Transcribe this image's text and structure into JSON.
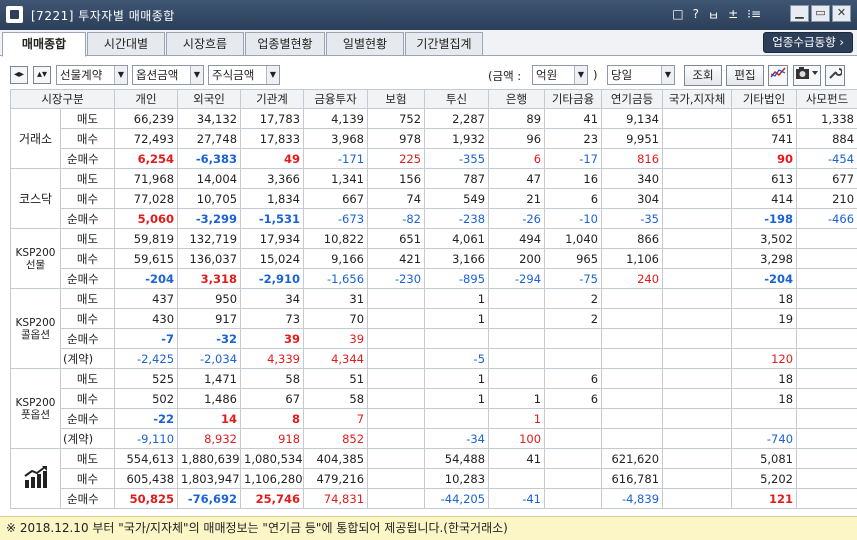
{
  "window": {
    "title": "[7221] 투자자별 매매종합",
    "icons": [
      "□",
      "?",
      "ㅂ",
      "±",
      "⁝≡"
    ],
    "buttons": [
      "▁",
      "▭",
      "✕"
    ]
  },
  "tabs": [
    {
      "label": "매매종합",
      "active": true
    },
    {
      "label": "시간대별"
    },
    {
      "label": "시장흐름"
    },
    {
      "label": "업종별현황"
    },
    {
      "label": "일별현황"
    },
    {
      "label": "기간별집계"
    }
  ],
  "tab_right": "업종수급동향 ›",
  "toolbar": {
    "combo1": "선물계약",
    "combo2": "옵션금액",
    "combo3": "주식금액",
    "amount_label": "(금액 :",
    "amount_unit": "억원",
    "close_paren": ")",
    "period": "당일",
    "query_label": "조회",
    "edit_label": "편집"
  },
  "columns": [
    "시장구분",
    "",
    "개인",
    "외국인",
    "기관계",
    "금융투자",
    "보험",
    "투신",
    "은행",
    "기타금융",
    "연기금등",
    "국가,지자체",
    "기타법인",
    "사모펀드"
  ],
  "groups": [
    {
      "name": "거래소",
      "rows": [
        {
          "label": "매도",
          "type": "sell",
          "values": [
            "66,239",
            "34,132",
            "17,783",
            "4,139",
            "752",
            "2,287",
            "89",
            "41",
            "9,134",
            "",
            "651",
            "1,338"
          ]
        },
        {
          "label": "매수",
          "type": "buy",
          "values": [
            "72,493",
            "27,748",
            "17,833",
            "3,968",
            "978",
            "1,932",
            "96",
            "23",
            "9,951",
            "",
            "741",
            "884"
          ]
        },
        {
          "label": "순매수",
          "type": "net",
          "values": [
            "6,254",
            "-6,383",
            "49",
            "-171",
            "225",
            "-355",
            "6",
            "-17",
            "816",
            "",
            "90",
            "-454"
          ]
        }
      ]
    },
    {
      "name": "코스닥",
      "rows": [
        {
          "label": "매도",
          "type": "sell",
          "values": [
            "71,968",
            "14,004",
            "3,366",
            "1,341",
            "156",
            "787",
            "47",
            "16",
            "340",
            "",
            "613",
            "677"
          ]
        },
        {
          "label": "매수",
          "type": "buy",
          "values": [
            "77,028",
            "10,705",
            "1,834",
            "667",
            "74",
            "549",
            "21",
            "6",
            "304",
            "",
            "414",
            "210"
          ]
        },
        {
          "label": "순매수",
          "type": "net",
          "values": [
            "5,060",
            "-3,299",
            "-1,531",
            "-673",
            "-82",
            "-238",
            "-26",
            "-10",
            "-35",
            "",
            "-198",
            "-466"
          ]
        }
      ]
    },
    {
      "name": "KSP200\n선물",
      "rows": [
        {
          "label": "매도",
          "type": "sell",
          "values": [
            "59,819",
            "132,719",
            "17,934",
            "10,822",
            "651",
            "4,061",
            "494",
            "1,040",
            "866",
            "",
            "3,502",
            ""
          ]
        },
        {
          "label": "매수",
          "type": "buy",
          "values": [
            "59,615",
            "136,037",
            "15,024",
            "9,166",
            "421",
            "3,166",
            "200",
            "965",
            "1,106",
            "",
            "3,298",
            ""
          ]
        },
        {
          "label": "순매수",
          "type": "net",
          "values": [
            "-204",
            "3,318",
            "-2,910",
            "-1,656",
            "-230",
            "-895",
            "-294",
            "-75",
            "240",
            "",
            "-204",
            ""
          ]
        }
      ]
    },
    {
      "name": "KSP200\n콜옵션",
      "rows": [
        {
          "label": "매도",
          "type": "sell",
          "values": [
            "437",
            "950",
            "34",
            "31",
            "",
            "1",
            "",
            "2",
            "",
            "",
            "18",
            ""
          ]
        },
        {
          "label": "매수",
          "type": "buy",
          "values": [
            "430",
            "917",
            "73",
            "70",
            "",
            "1",
            "",
            "2",
            "",
            "",
            "19",
            ""
          ]
        },
        {
          "label": "순매수",
          "type": "net",
          "values": [
            "-7",
            "-32",
            "39",
            "39",
            "",
            "",
            "",
            "",
            "",
            "",
            "",
            ""
          ]
        },
        {
          "label": "(계약)",
          "type": "ctr",
          "values": [
            "-2,425",
            "-2,034",
            "4,339",
            "4,344",
            "",
            "-5",
            "",
            "",
            "",
            "",
            "120",
            ""
          ]
        }
      ]
    },
    {
      "name": "KSP200\n풋옵션",
      "rows": [
        {
          "label": "매도",
          "type": "sell",
          "values": [
            "525",
            "1,471",
            "58",
            "51",
            "",
            "1",
            "",
            "6",
            "",
            "",
            "18",
            ""
          ]
        },
        {
          "label": "매수",
          "type": "buy",
          "values": [
            "502",
            "1,486",
            "67",
            "58",
            "",
            "1",
            "1",
            "6",
            "",
            "",
            "18",
            ""
          ]
        },
        {
          "label": "순매수",
          "type": "net",
          "values": [
            "-22",
            "14",
            "8",
            "7",
            "",
            "",
            "1",
            "",
            "",
            "",
            "",
            ""
          ]
        },
        {
          "label": "(계약)",
          "type": "ctr",
          "values": [
            "-9,110",
            "8,932",
            "918",
            "852",
            "",
            "-34",
            "100",
            "",
            "",
            "",
            "-740",
            ""
          ]
        }
      ]
    },
    {
      "name": "",
      "icon": "chart-bars-icon",
      "rows": [
        {
          "label": "매도",
          "type": "sell",
          "values": [
            "554,613",
            "1,880,639",
            "1,080,534",
            "404,385",
            "",
            "54,488",
            "41",
            "",
            "621,620",
            "",
            "5,081",
            ""
          ]
        },
        {
          "label": "매수",
          "type": "buy",
          "values": [
            "605,438",
            "1,803,947",
            "1,106,280",
            "479,216",
            "",
            "10,283",
            "",
            "",
            "616,781",
            "",
            "5,202",
            ""
          ]
        },
        {
          "label": "순매수",
          "type": "net",
          "values": [
            "50,825",
            "-76,692",
            "25,746",
            "74,831",
            "",
            "-44,205",
            "-41",
            "",
            "-4,839",
            "",
            "121",
            ""
          ]
        }
      ]
    }
  ],
  "footer": "※ 2018.12.10 부터 \"국가/지자체\"의 매매정보는 \"연기금 등\"에 통합되어 제공됩니다.(한국거래소)"
}
